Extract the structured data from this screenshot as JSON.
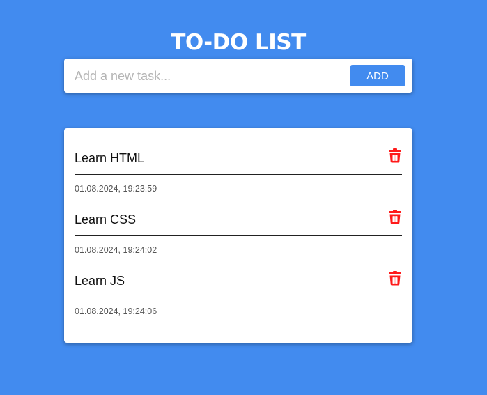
{
  "header": {
    "title": "TO-DO LIST"
  },
  "input": {
    "placeholder": "Add a new task...",
    "value": "",
    "add_label": "ADD"
  },
  "tasks": [
    {
      "text": "Learn HTML",
      "timestamp": "01.08.2024, 19:23:59",
      "icon": "trash-icon"
    },
    {
      "text": "Learn CSS",
      "timestamp": "01.08.2024, 19:24:02",
      "icon": "trash-icon"
    },
    {
      "text": "Learn JS",
      "timestamp": "01.08.2024, 19:24:06",
      "icon": "trash-icon"
    }
  ],
  "colors": {
    "background": "#428bef",
    "accent": "#428bef",
    "delete": "#ff1a1a",
    "card": "#ffffff"
  }
}
